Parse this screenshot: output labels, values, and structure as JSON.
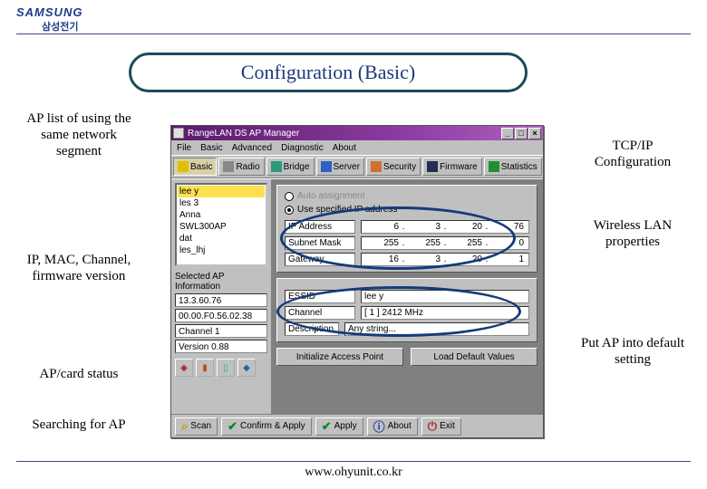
{
  "brand": {
    "main": "SAMSUNG",
    "sub": "삼성전기"
  },
  "slide_title": "Configuration (Basic)",
  "footer": "www.ohyunit.co.kr",
  "annotations": {
    "ap_list": "AP list of using the same network segment",
    "ip_mac": "IP, MAC, Channel, firmware version",
    "ap_status": "AP/card status",
    "searching": "Searching for AP",
    "tcpip": "TCP/IP Configuration",
    "wlan_props": "Wireless LAN properties",
    "default": "Put AP into default setting"
  },
  "app": {
    "title": "RangeLAN DS AP Manager",
    "menu": [
      "File",
      "Basic",
      "Advanced",
      "Diagnostic",
      "About"
    ],
    "toolbar": [
      {
        "label": "Basic",
        "active": true
      },
      {
        "label": "Radio"
      },
      {
        "label": "Bridge"
      },
      {
        "label": "Server"
      },
      {
        "label": "Security"
      },
      {
        "label": "Firmware"
      },
      {
        "label": "Statistics"
      }
    ],
    "ap_list": [
      "lee y",
      "les 3",
      "Anna",
      "SWL300AP",
      "dat",
      "les_lhj"
    ],
    "side_label": "Selected AP Information",
    "info": {
      "ip": "13.3.60.76",
      "mac": "00.00.F0.56.02.38",
      "channel": "Channel 1",
      "version": "Version 0.88"
    },
    "panel1": {
      "radio_auto": "Auto assignment",
      "radio_manual": "Use specified IP address",
      "fields": {
        "ip_label": "IP Address",
        "ip_value": [
          "6",
          "3",
          "20",
          "76"
        ],
        "mask_label": "Subnet Mask",
        "mask_value": [
          "255",
          "255",
          "255",
          "0"
        ],
        "gw_label": "Gateway",
        "gw_value": [
          "16",
          "3",
          "20",
          "1"
        ]
      }
    },
    "panel2": {
      "essid_label": "ESSID",
      "essid_value": "lee y",
      "channel_label": "Channel",
      "channel_value": "[ 1 ] 2412 MHz",
      "desc_label": "Description",
      "desc_value": "Any string..."
    },
    "buttons": {
      "init": "Initialize Access Point",
      "load_default": "Load Default Values"
    },
    "bottom": {
      "scan": "Scan",
      "confirm": "Confirm & Apply",
      "apply": "Apply",
      "about": "About",
      "exit": "Exit"
    }
  }
}
